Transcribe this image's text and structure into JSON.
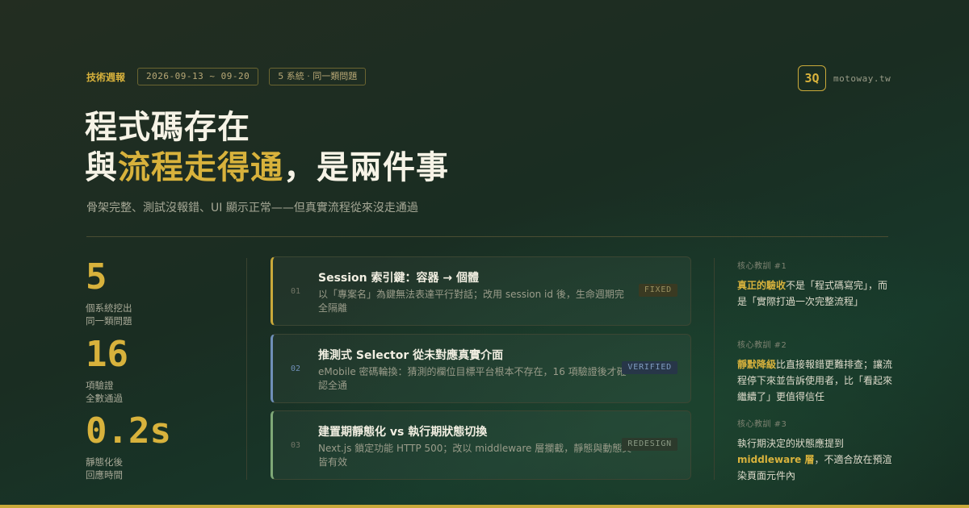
{
  "header": {
    "kicker": "技術週報",
    "date_range": "2026-09-13 ~ 09-20",
    "scope": "5 系統 · 同一類問題"
  },
  "brand": {
    "logo": "3Q",
    "site": "motoway.tw"
  },
  "headline": {
    "line1": "程式碼存在",
    "line2_before": "與",
    "line2_highlight": "流程走得通",
    "line2_after": "，是兩件事",
    "subtitle": "骨架完整、測試沒報錯、UI 顯示正常——但真實流程從來沒走通過"
  },
  "stats": [
    {
      "value": "5",
      "label_line1": "個系統挖出",
      "label_line2": "同一類問題"
    },
    {
      "value": "16",
      "label_line1": "項驗證",
      "label_line2": "全數通過"
    },
    {
      "value": "0.2s",
      "label_line1": "靜態化後",
      "label_line2": "回應時間"
    }
  ],
  "cases": [
    {
      "num": "01",
      "title": "Session 索引鍵：容器 → 個體",
      "desc": "以「專案名」為鍵無法表達平行對話；改用 session id 後，生命週期完全隔離",
      "tag": "FIXED",
      "accent": "#c9a93a"
    },
    {
      "num": "02",
      "title": "推測式 Selector 從未對應真實介面",
      "desc": "eMobile 密碼輪換：猜測的欄位目標平台根本不存在，16 項驗證後才確認全通",
      "tag": "VERIFIED",
      "accent": "#6f8fb8"
    },
    {
      "num": "03",
      "title": "建置期靜態化 vs 執行期狀態切換",
      "desc": "Next.js 鎖定功能 HTTP 500；改以 middleware 層攔截，靜態與動態頁皆有效",
      "tag": "REDESIGN",
      "accent": "#7fa877"
    }
  ],
  "lessons": [
    {
      "kicker": "核心教訓 #1",
      "em": "真正的驗收",
      "pre": "",
      "post": "不是「程式碼寫完」，而是「實際打過一次完整流程」"
    },
    {
      "kicker": "核心教訓 #2",
      "em": "靜默降級",
      "pre": "",
      "post": "比直接報錯更難排查；讓流程停下來並告訴使用者，比「看起來繼續了」更值得信任"
    },
    {
      "kicker": "核心教訓 #3",
      "em": "middleware 層",
      "pre": "執行期決定的狀態應提到",
      "post": "，不適合放在預渲染頁面元件內"
    }
  ],
  "colors": {
    "accent": "#d8b23c",
    "background": "#1a2d22"
  }
}
